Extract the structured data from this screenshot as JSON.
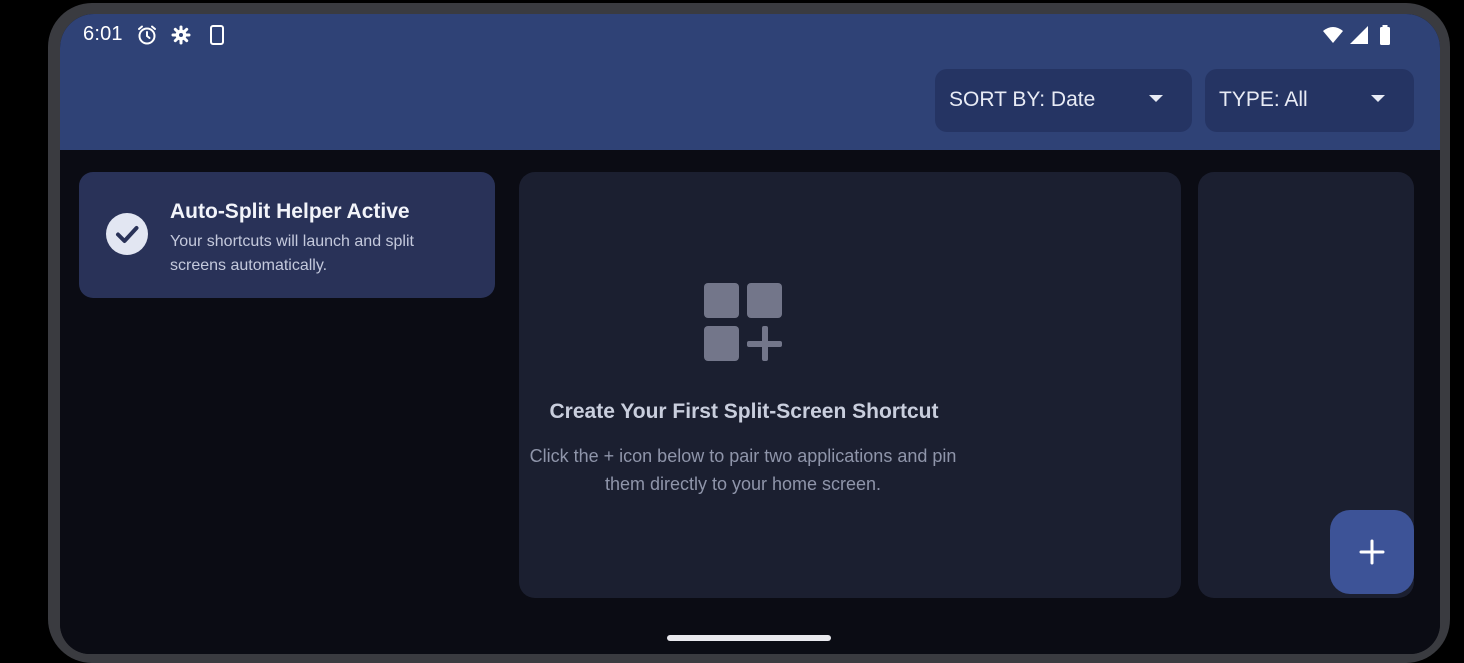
{
  "status_bar": {
    "time": "6:01",
    "left_icons": [
      "alarm-icon",
      "settings-gear-icon",
      "device-icon"
    ],
    "right_icons": [
      "wifi-icon",
      "cell-signal-icon",
      "battery-icon"
    ]
  },
  "header": {
    "sort_label": "SORT BY: Date",
    "type_label": "TYPE: All"
  },
  "helper_card": {
    "title": "Auto-Split Helper Active",
    "description": "Your shortcuts will launch and split screens automatically.",
    "icon": "check-circle-icon"
  },
  "empty_state": {
    "icon": "grid-add-icon",
    "title": "Create Your First Split-Screen Shortcut",
    "description": "Click the + icon below to pair two applications and pin them directly to your home screen."
  },
  "fab": {
    "icon": "plus-icon"
  },
  "colors": {
    "header_bg": "#2f4276",
    "dropdown_bg": "#253463",
    "content_bg": "#0b0c14",
    "card_bg": "#1b1f30",
    "helper_card_bg": "#293258",
    "fab_bg": "#3d5397"
  }
}
